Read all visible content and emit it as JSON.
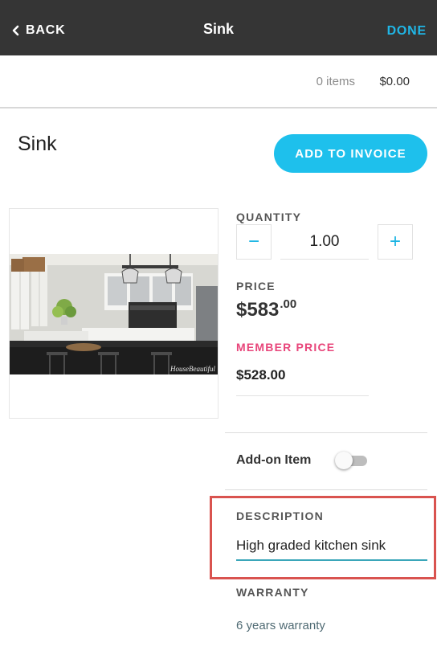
{
  "nav": {
    "back_label": "BACK",
    "title": "Sink",
    "done_label": "DONE"
  },
  "summary": {
    "items": "0 items",
    "total": "$0.00"
  },
  "product": {
    "title": "Sink",
    "add_to_invoice_label": "ADD TO INVOICE",
    "image_watermark": "HouseBeautiful"
  },
  "quantity": {
    "label": "QUANTITY",
    "minus_symbol": "−",
    "plus_symbol": "+",
    "value": "1.00"
  },
  "price": {
    "label": "PRICE",
    "whole": "$583",
    "cents": ".00"
  },
  "member_price": {
    "label": "MEMBER PRICE",
    "value": "$528.00"
  },
  "addon": {
    "label": "Add-on Item",
    "enabled": false
  },
  "description": {
    "label": "DESCRIPTION",
    "value": "High graded kitchen sink"
  },
  "warranty": {
    "label": "WARRANTY",
    "value": "6 years warranty"
  },
  "colors": {
    "navbar": "#353535",
    "accent": "#1ec0ec",
    "member_price_label": "#e8457a",
    "highlight": "#d9534f",
    "input_underline": "#3aa6b9"
  }
}
